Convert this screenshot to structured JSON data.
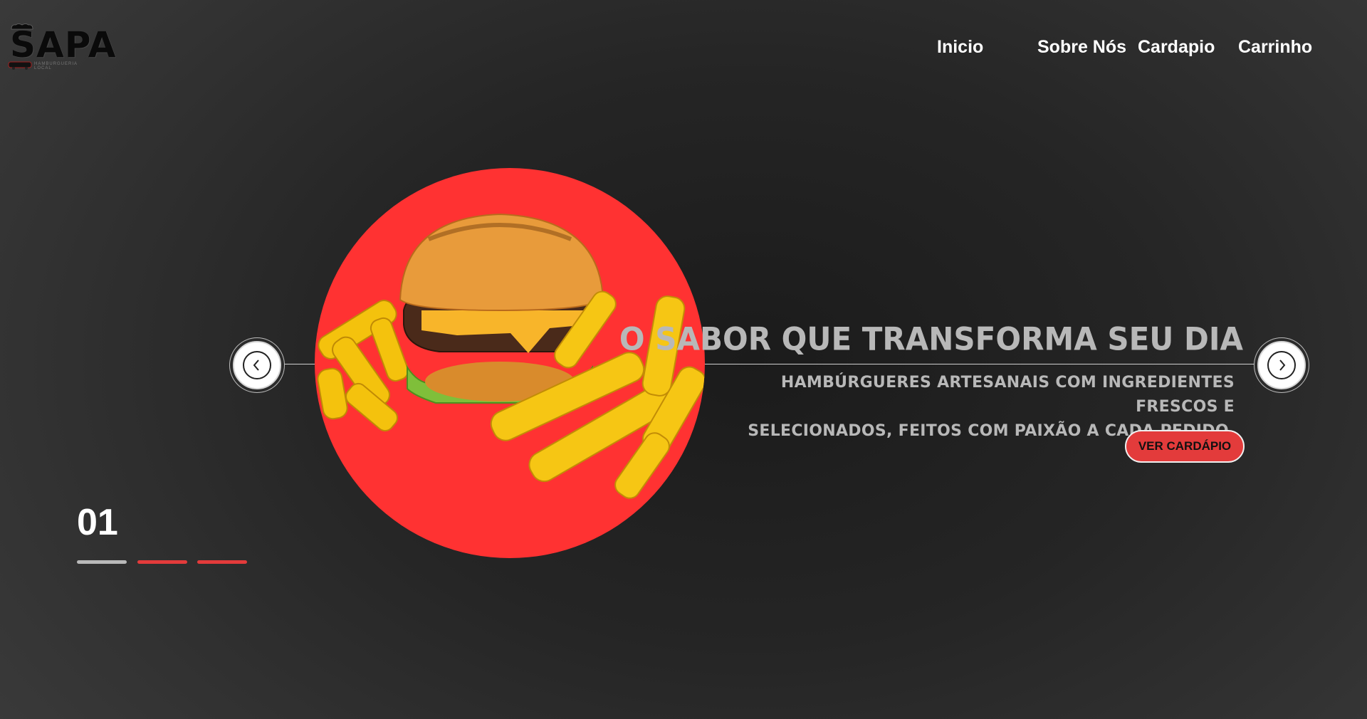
{
  "logo": {
    "text": "SAPA",
    "tagline": "HAMBURGUERIA LOCAL"
  },
  "nav": {
    "items": [
      {
        "label": "Inicio"
      },
      {
        "label": "Sobre Nós"
      },
      {
        "label": "Cardapio"
      },
      {
        "label": "Carrinho"
      }
    ]
  },
  "hero": {
    "headline": "O SABOR QUE TRANSFORMA SEU DIA",
    "subtitle_line1": "HAMBÚRGUERES ARTESANAIS COM INGREDIENTES FRESCOS E",
    "subtitle_line2": "SELECIONADOS, FEITOS COM PAIXÃO A CADA PEDIDO.",
    "cta_label": "VER CARDÁPIO",
    "image_icon": "burger-fries-photo",
    "image_bg": "#ff3232"
  },
  "slider": {
    "counter": "01",
    "prev_icon": "chevron-left-icon",
    "next_icon": "chevron-right-icon",
    "indicators": [
      {
        "state": "active",
        "color": "#b9b9b9"
      },
      {
        "state": "inactive",
        "color": "#e33b3b"
      },
      {
        "state": "inactive",
        "color": "#e33b3b"
      }
    ]
  },
  "colors": {
    "accent": "#e33b3b",
    "text_muted": "#b8b8b8"
  }
}
